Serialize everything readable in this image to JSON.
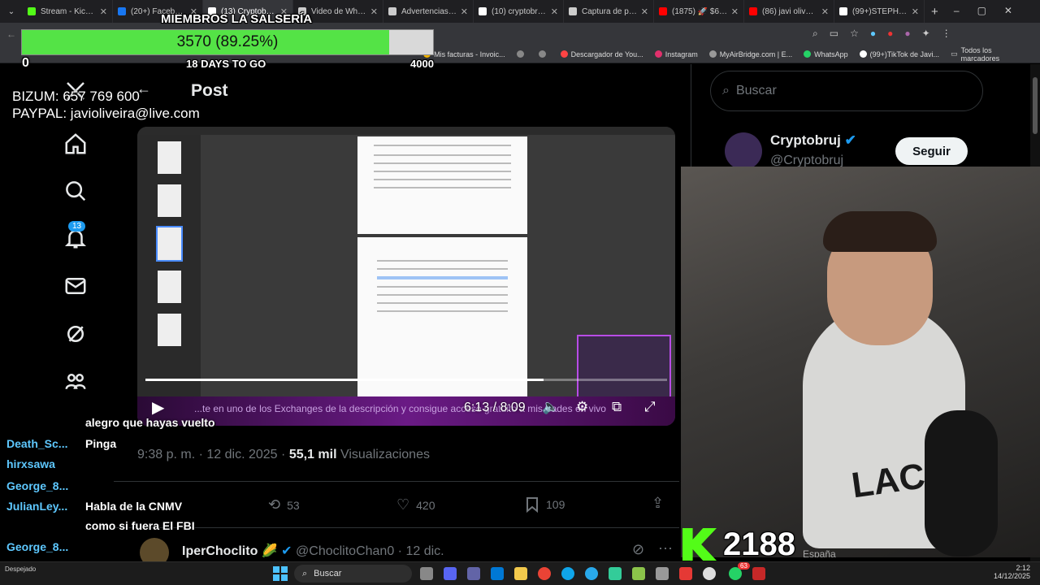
{
  "browser": {
    "tabs": [
      {
        "title": "Stream - Kick Das",
        "color": "#53fc18"
      },
      {
        "title": "(20+) Facebook",
        "color": "#1877f2"
      },
      {
        "title": "(13) Cryptobruj en X",
        "color": "#ffffff"
      },
      {
        "title": "Video de WhatsApp",
        "color": "#cccccc"
      },
      {
        "title": "Advertencias CNMV",
        "color": "#cccccc"
      },
      {
        "title": "(10) cryptobruj de",
        "color": "#ffffff"
      },
      {
        "title": "Captura de pantalla",
        "color": "#cccccc"
      },
      {
        "title": "(1875) 🚀 $6.000",
        "color": "#ff0000"
      },
      {
        "title": "(86) javi oliveira",
        "color": "#ff0000"
      },
      {
        "title": "(99+)STEPHANIE",
        "color": "#ffffff"
      }
    ],
    "new_tab": "+",
    "bookmarks": [
      {
        "label": "Mis facturas - Invoic...",
        "color": "#f4b400"
      },
      {
        "label": "",
        "color": "#888888"
      },
      {
        "label": "",
        "color": "#888888"
      },
      {
        "label": "Descargador de You...",
        "color": "#ff4444"
      },
      {
        "label": "Instagram",
        "color": "#e1306c"
      },
      {
        "label": "MyAirBridge.com | E...",
        "color": "#999999"
      },
      {
        "label": "WhatsApp",
        "color": "#25d366"
      },
      {
        "label": "(99+)TikTok de Javi...",
        "color": "#ffffff"
      }
    ],
    "all_bookmarks": "Todos los marcadores"
  },
  "overlay": {
    "goal_title": "MIEMBROS LA SALSERÍA",
    "goal_value": "3570 (89.25%)",
    "goal_fraction": 0.8925,
    "goal_min": "0",
    "goal_max": "4000",
    "goal_deadline": "18 DAYS TO GO",
    "bizum": "BIZUM: 657 769 600",
    "paypal": "PAYPAL: javioliveira@live.com",
    "kick_count": "2188"
  },
  "post": {
    "header": "Post",
    "video_time": "6:13 / 8:09",
    "video_progress": 0.763,
    "caption_overlay": "...te en uno de los Exchanges de la descripción y consigue acceso gratuito a mis trades en vivo",
    "timestamp_time": "9:38 p. m.",
    "timestamp_date": "12 dic. 2025",
    "views_count": "55,1 mil",
    "views_label": "Visualizaciones",
    "retweets": "53",
    "likes": "420",
    "bookmarks": "109",
    "reply": {
      "name": "IperChoclito",
      "handle": "@ChoclitoChan0 · 12 dic."
    }
  },
  "nav": {
    "notifications_badge": "13"
  },
  "sidebar": {
    "search_placeholder": "Buscar",
    "account_name": "Cryptobruj",
    "account_handle": "@Cryptobruj",
    "follow_label": "Seguir"
  },
  "chat": [
    {
      "user": "",
      "msg": "alegro que hayas vuelto"
    },
    {
      "user": "Death_Sc...",
      "msg": "Pinga"
    },
    {
      "user": "hirxsawa",
      "msg": ""
    },
    {
      "user": "George_8...",
      "msg": ""
    },
    {
      "user": "JulianLey...",
      "msg": "Habla de la CNMV"
    },
    {
      "user": "",
      "msg": "como si fuera El FBI"
    },
    {
      "user": "George_8...",
      "msg": ""
    },
    {
      "user": "George_8...",
      "msg": ""
    }
  ],
  "webcam": {
    "shirt_text": "LACO",
    "bg_text": "España"
  },
  "taskbar": {
    "search": "Buscar",
    "weather": "Despejado",
    "time": "2:12",
    "date": "14/12/2025",
    "badge": "63"
  }
}
